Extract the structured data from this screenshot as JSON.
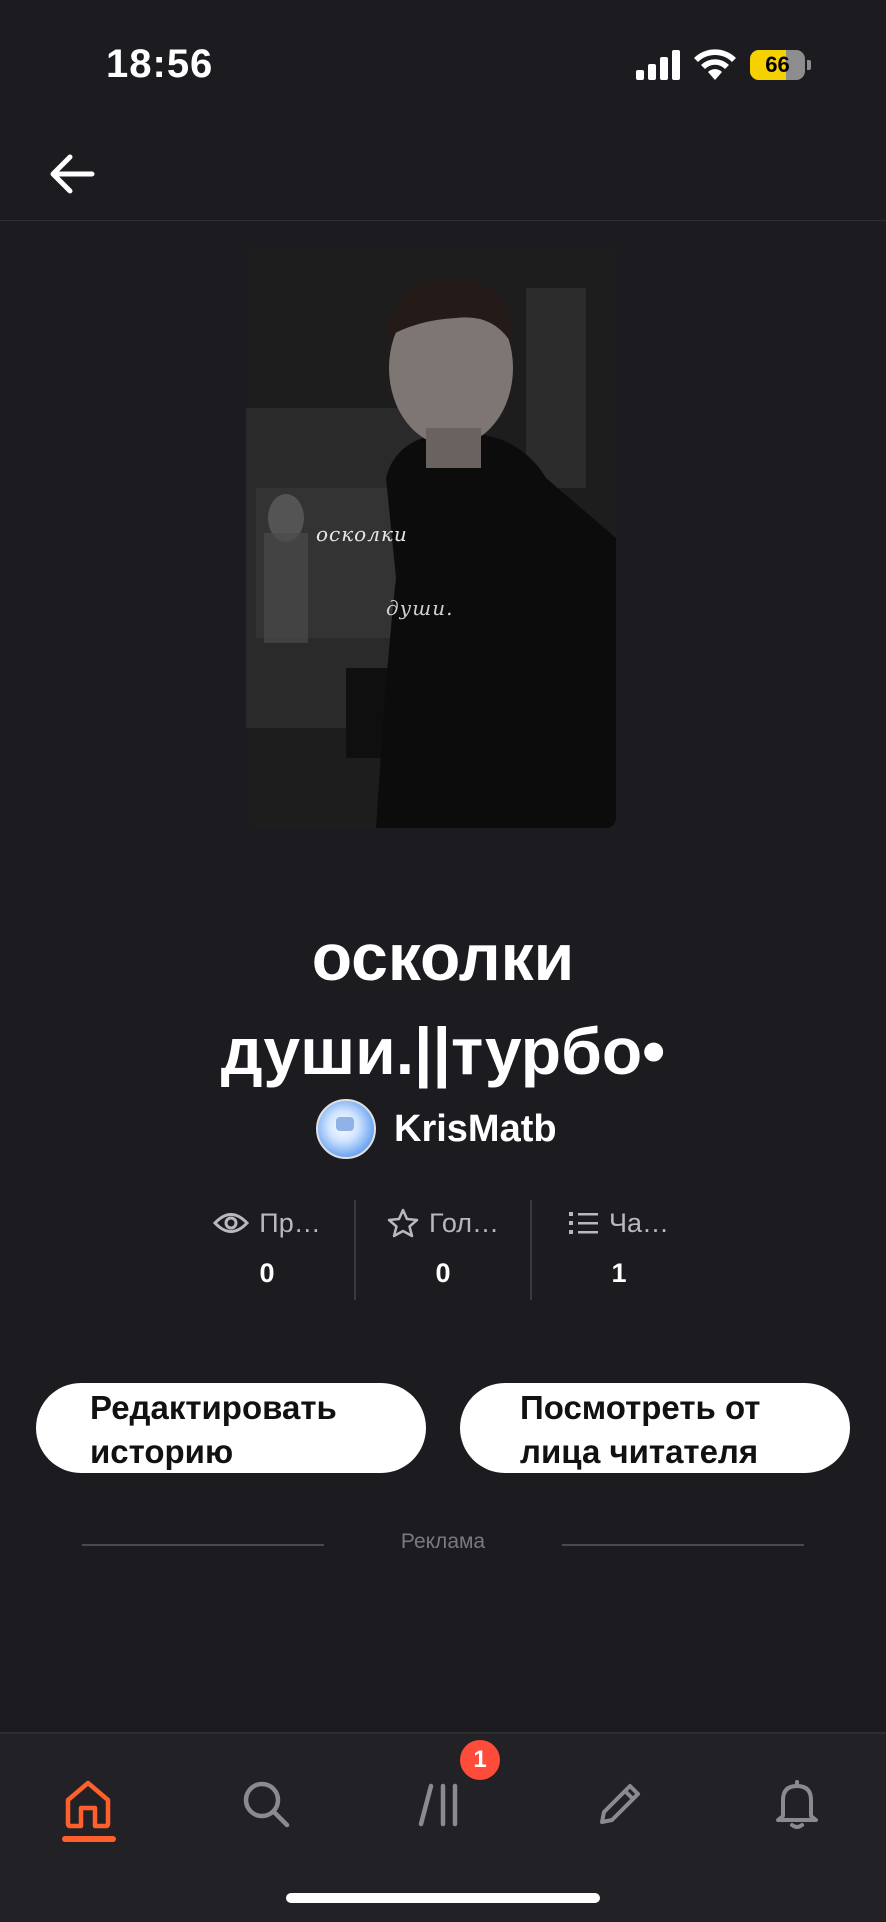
{
  "status_bar": {
    "time": "18:56",
    "battery_level": "66",
    "battery_fraction": 0.66,
    "battery_color": "#f5d100"
  },
  "header": {
    "back_icon": "arrow-left-icon"
  },
  "cover": {
    "line1": "осколки",
    "line2": "души."
  },
  "story": {
    "title_line1": "осколки",
    "title_line2": "души.||турбо•",
    "author": "KrisMatb"
  },
  "stats": [
    {
      "icon": "eye-icon",
      "label": "Пр…",
      "value": "0"
    },
    {
      "icon": "star-icon",
      "label": "Гол…",
      "value": "0"
    },
    {
      "icon": "list-icon",
      "label": "Ча…",
      "value": "1"
    }
  ],
  "actions": {
    "edit_line1": "Редактировать",
    "edit_line2": "историю",
    "preview_line1": "Посмотреть от",
    "preview_line2": "лица читателя"
  },
  "ad_label": "Реклама",
  "tabbar": {
    "active_color": "#ff5f2b",
    "items": [
      "home-icon",
      "search-icon",
      "library-icon",
      "pencil-icon",
      "bell-icon"
    ],
    "library_badge": "1"
  }
}
